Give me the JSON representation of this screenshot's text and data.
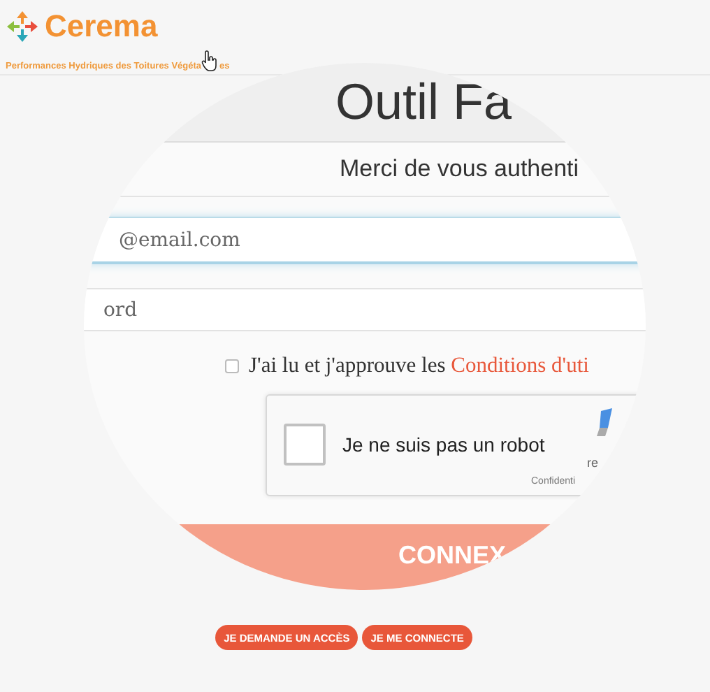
{
  "header": {
    "brand": "Cerema",
    "subtitle": "Performances Hydriques des Toitures Végéta",
    "subtitle_end": "es"
  },
  "magnifier": {
    "title": "Outil Fa",
    "prompt": "Merci de vous authenti",
    "email": {
      "placeholder": "@email.com"
    },
    "password": {
      "placeholder": "ord"
    },
    "consent": {
      "checked": false,
      "text": "J'ai lu et j'approuve les",
      "link": "Conditions d'uti"
    },
    "captcha": {
      "checked": false,
      "label": "Je ne suis pas un robot",
      "brand_fragment": "re",
      "privacy_fragment": "Confidenti"
    },
    "submit": "CONNEX"
  },
  "buttons": [
    "JE DEMANDE UN ACCÈS",
    "JE ME CONNECTE"
  ]
}
